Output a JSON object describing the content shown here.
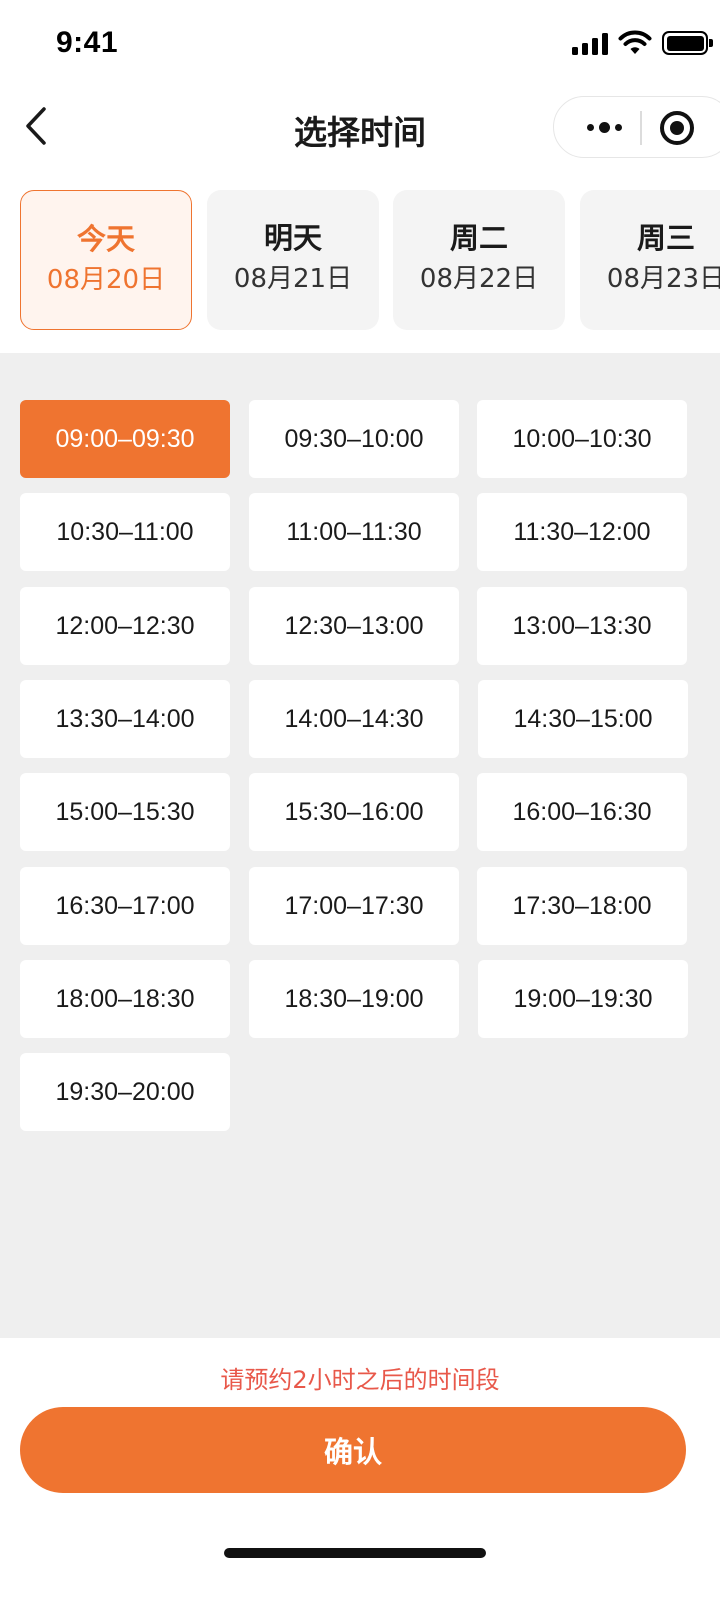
{
  "status_bar": {
    "time": "9:41",
    "icons": [
      "signal-icon",
      "wifi-icon",
      "battery-icon"
    ]
  },
  "nav": {
    "title": "选择时间",
    "back_icon": "chevron-left-icon",
    "more_icon": "more-dots-icon",
    "close_icon": "record-circle-icon"
  },
  "date_tabs": [
    {
      "day": "今天",
      "date": "08月20日",
      "active": true
    },
    {
      "day": "明天",
      "date": "08月21日",
      "active": false
    },
    {
      "day": "周二",
      "date": "08月22日",
      "active": false
    },
    {
      "day": "周三",
      "date": "08月23日",
      "active": false
    }
  ],
  "time_slots": [
    {
      "label": "09:00–09:30",
      "selected": true
    },
    {
      "label": "09:30–10:00",
      "selected": false
    },
    {
      "label": "10:00–10:30",
      "selected": false
    },
    {
      "label": "10:30–11:00",
      "selected": false
    },
    {
      "label": "11:00–11:30",
      "selected": false
    },
    {
      "label": "11:30–12:00",
      "selected": false
    },
    {
      "label": "12:00–12:30",
      "selected": false
    },
    {
      "label": "12:30–13:00",
      "selected": false
    },
    {
      "label": "13:00–13:30",
      "selected": false
    },
    {
      "label": "13:30–14:00",
      "selected": false
    },
    {
      "label": "14:00–14:30",
      "selected": false
    },
    {
      "label": "14:30–15:00",
      "selected": false
    },
    {
      "label": "15:00–15:30",
      "selected": false
    },
    {
      "label": "15:30–16:00",
      "selected": false
    },
    {
      "label": "16:00–16:30",
      "selected": false
    },
    {
      "label": "16:30–17:00",
      "selected": false
    },
    {
      "label": "17:00–17:30",
      "selected": false
    },
    {
      "label": "17:30–18:00",
      "selected": false
    },
    {
      "label": "18:00–18:30",
      "selected": false
    },
    {
      "label": "18:30–19:00",
      "selected": false
    },
    {
      "label": "19:00–19:30",
      "selected": false
    },
    {
      "label": "19:30–20:00",
      "selected": false
    }
  ],
  "footer": {
    "hint": "请预约2小时之后的时间段",
    "confirm_label": "确认"
  },
  "colors": {
    "accent": "#ef7430",
    "accent_light": "#fff4ee",
    "hint_red": "#e8584a",
    "slot_area_bg": "#efefef",
    "tab_bg": "#f4f4f4"
  }
}
